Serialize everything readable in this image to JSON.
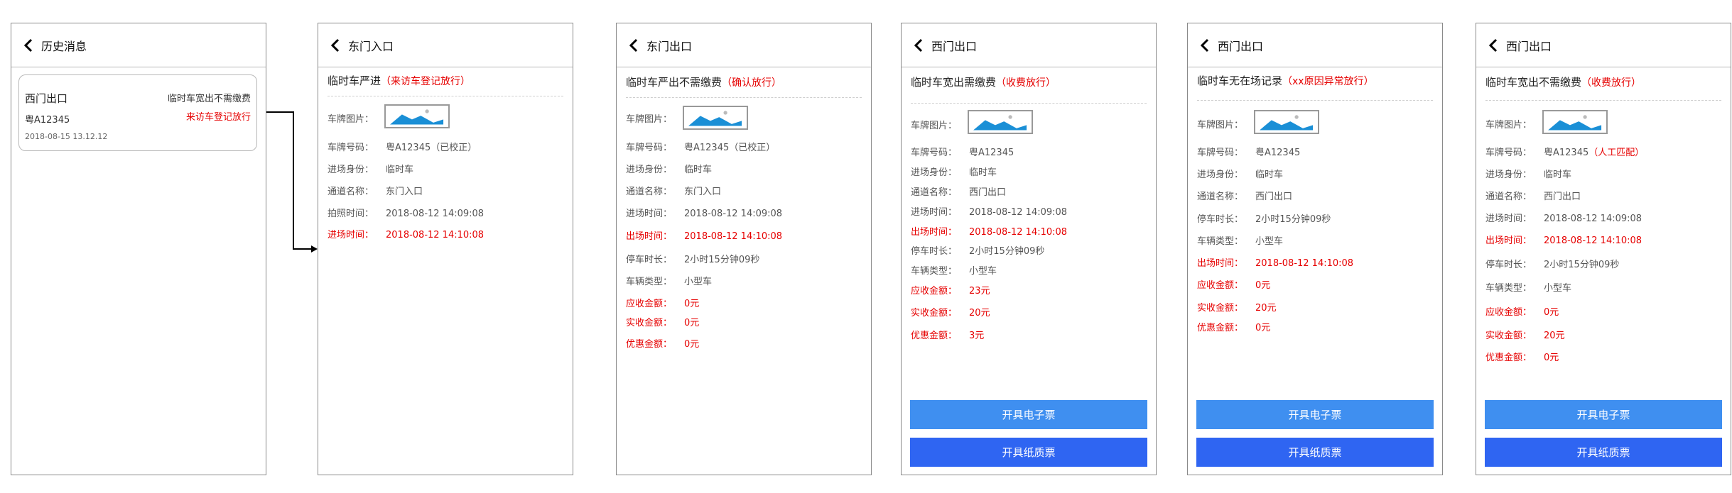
{
  "history": {
    "title": "历史消息",
    "card": {
      "location": "西门出口",
      "status": "临时车宽出不需缴费",
      "plate": "粤A12345",
      "tag": "来访车登记放行",
      "time": "2018-08-15 13.12.12"
    }
  },
  "screens": [
    {
      "title": "东门入口",
      "sub": "临时车严进",
      "tag": "（来访车登记放行）",
      "image_label": "车牌图片：",
      "rows": [
        {
          "label": "车牌号码：",
          "value": "粤A12345（已校正）"
        },
        {
          "label": "进场身份：",
          "value": "临时车"
        },
        {
          "label": "通道名称：",
          "value": "东门入口"
        },
        {
          "label": "拍照时间：",
          "value": "2018-08-12 14:09:08"
        },
        {
          "label": "进场时间：",
          "value": "2018-08-12 14:10:08"
        }
      ]
    },
    {
      "title": "东门出口",
      "sub": "临时车严出不需缴费",
      "tag": "（确认放行）",
      "image_label": "车牌图片：",
      "rows": [
        {
          "label": "车牌号码：",
          "value": "粤A12345（已校正）"
        },
        {
          "label": "进场身份：",
          "value": "临时车"
        },
        {
          "label": "通道名称：",
          "value": "东门入口"
        },
        {
          "label": "进场时间：",
          "value": "2018-08-12 14:09:08"
        },
        {
          "label": "出场时间：",
          "value": "2018-08-12 14:10:08"
        },
        {
          "label": "停车时长：",
          "value": "2小时15分钟09秒"
        },
        {
          "label": "车辆类型：",
          "value": "小型车"
        },
        {
          "label": "应收金额：",
          "value": "0元"
        },
        {
          "label": "实收金额：",
          "value": "0元"
        },
        {
          "label": "优惠金额：",
          "value": "0元"
        }
      ]
    },
    {
      "title": "西门出口",
      "sub": "临时车宽出需缴费",
      "tag": "（收费放行）",
      "image_label": "车牌图片：",
      "rows": [
        {
          "label": "车牌号码：",
          "value": "粤A12345"
        },
        {
          "label": "进场身份：",
          "value": "临时车"
        },
        {
          "label": "通道名称：",
          "value": "西门出口"
        },
        {
          "label": "进场时间：",
          "value": "2018-08-12 14:09:08"
        },
        {
          "label": "出场时间：",
          "value": "2018-08-12 14:10:08"
        },
        {
          "label": "停车时长：",
          "value": "2小时15分钟09秒"
        },
        {
          "label": "车辆类型：",
          "value": "小型车"
        },
        {
          "label": "应收金额：",
          "value": "23元"
        },
        {
          "label": "实收金额：",
          "value": "20元"
        },
        {
          "label": "优惠金额：",
          "value": "3元"
        }
      ],
      "buttons": {
        "electronic": "开具电子票",
        "paper": "开具纸质票"
      }
    },
    {
      "title": "西门出口",
      "sub": "临时车无在场记录",
      "tag": "（xx原因异常放行）",
      "image_label": "车牌图片：",
      "rows": [
        {
          "label": "车牌号码：",
          "value": "粤A12345"
        },
        {
          "label": "进场身份：",
          "value": "临时车"
        },
        {
          "label": "通道名称：",
          "value": "西门出口"
        },
        {
          "label": "停车时长：",
          "value": "2小时15分钟09秒"
        },
        {
          "label": "车辆类型：",
          "value": "小型车"
        },
        {
          "label": "出场时间：",
          "value": "2018-08-12 14:10:08"
        },
        {
          "label": "应收金额：",
          "value": "0元"
        },
        {
          "label": "实收金额：",
          "value": "20元"
        },
        {
          "label": "优惠金额：",
          "value": "0元"
        }
      ],
      "buttons": {
        "electronic": "开具电子票",
        "paper": "开具纸质票"
      }
    },
    {
      "title": "西门出口",
      "sub": "临时车宽出不需缴费",
      "tag": "（收费放行）",
      "image_label": "车牌图片：",
      "rows": [
        {
          "label": "车牌号码：",
          "value": "粤A12345",
          "note": "（人工匹配）"
        },
        {
          "label": "进场身份：",
          "value": "临时车"
        },
        {
          "label": "通道名称：",
          "value": "西门出口"
        },
        {
          "label": "进场时间：",
          "value": "2018-08-12 14:09:08"
        },
        {
          "label": "出场时间：",
          "value": "2018-08-12 14:10:08"
        },
        {
          "label": "停车时长：",
          "value": "2小时15分钟09秒"
        },
        {
          "label": "车辆类型：",
          "value": "小型车"
        },
        {
          "label": "应收金额：",
          "value": "0元"
        },
        {
          "label": "实收金额：",
          "value": "20元"
        },
        {
          "label": "优惠金额：",
          "value": "0元"
        }
      ],
      "buttons": {
        "electronic": "开具电子票",
        "paper": "开具纸质票"
      }
    }
  ]
}
